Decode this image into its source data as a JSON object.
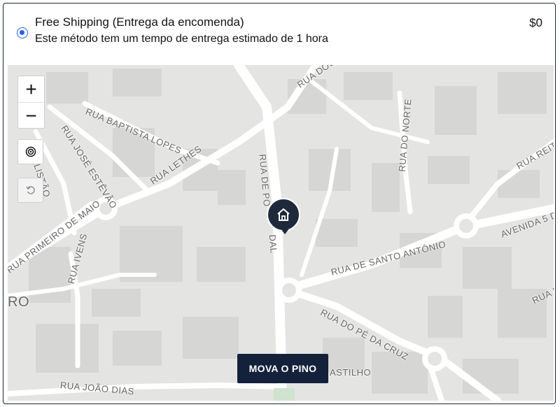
{
  "shipping": {
    "method_name": "Free Shipping (Entrega da encomenda)",
    "method_description": "Este método tem um tempo de entrega estimado de 1 hora",
    "price": "$0",
    "selected": true
  },
  "map": {
    "controls": {
      "zoom_in_label": "+",
      "zoom_out_label": "−",
      "locate_icon": "target-icon",
      "reset_icon": "undo-icon"
    },
    "street_labels": [
      "RUA DOU",
      "RUA BAPTISTA LOPES",
      "RUA JOSÉ ESTÊVÃO",
      "PE ALISTÃO",
      "RUA LETHES",
      "RUA DE PO",
      "DAL",
      "RUA DO NORTE",
      "RUA REITO",
      "AVENIDA 5 D",
      "RUA PRIMEIRO DE MAIO",
      "RUA IVENS",
      "RUA DE SANTO ANTÓNIO",
      "RUA DO PÉ DA CRUZ",
      "RUA JOÃO DIAS",
      "ASTILHO",
      "RO",
      "RUA DE"
    ],
    "pin_icon": "home-icon",
    "move_pin_label": "MOVA O PINO"
  },
  "colors": {
    "accent": "#2563eb",
    "pin": "#1e293b",
    "button": "#13213b",
    "map_bg": "#e4e4e2"
  }
}
